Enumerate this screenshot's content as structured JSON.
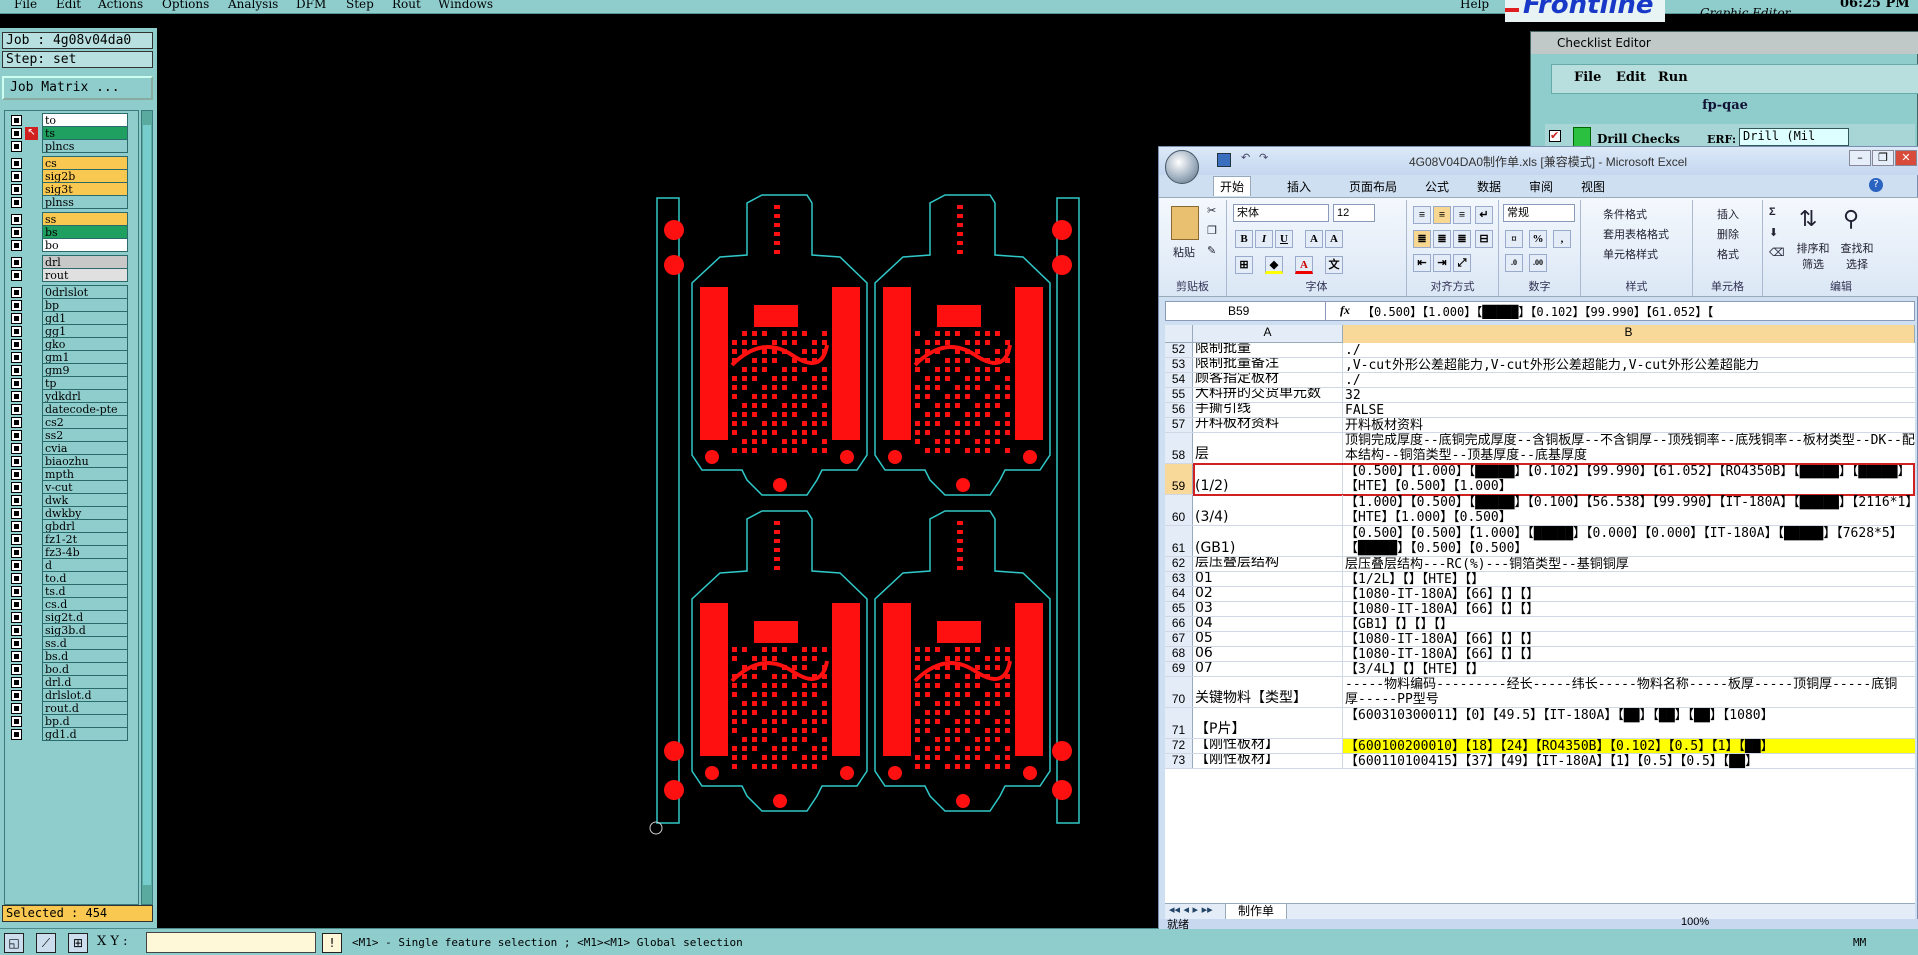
{
  "menubar": {
    "items": [
      "File",
      "Edit",
      "Actions",
      "Options",
      "Analysis",
      "DFM",
      "Step",
      "Rout",
      "Windows"
    ],
    "help": "Help",
    "brand": "Frontline",
    "editor_name": "Graphic Editor",
    "clock": "06:25 PM"
  },
  "leftpanel": {
    "job": "Job : 4g08v04da0",
    "step": "Step: set",
    "job_matrix": "Job Matrix ...",
    "layers": [
      {
        "name": "to",
        "color": "#ffffff"
      },
      {
        "name": "ts",
        "color": "#20a060"
      },
      {
        "name": "plncs",
        "color": "#8fcdcd"
      },
      {
        "name": "cs",
        "color": "#f8c850"
      },
      {
        "name": "sig2b",
        "color": "#f8c850"
      },
      {
        "name": "sig3t",
        "color": "#f8c850"
      },
      {
        "name": "plnss",
        "color": "#8fcdcd"
      },
      {
        "name": "ss",
        "color": "#f8c850"
      },
      {
        "name": "bs",
        "color": "#20a060"
      },
      {
        "name": "bo",
        "color": "#ffffff"
      },
      {
        "name": "drl",
        "color": "#c8c8c8"
      },
      {
        "name": "rout",
        "color": "#e0e0e0"
      },
      {
        "name": "0drlslot",
        "color": "#8fcdcd"
      },
      {
        "name": "bp",
        "color": "#8fcdcd"
      },
      {
        "name": "gd1",
        "color": "#8fcdcd"
      },
      {
        "name": "gg1",
        "color": "#8fcdcd"
      },
      {
        "name": "gko",
        "color": "#8fcdcd"
      },
      {
        "name": "gm1",
        "color": "#8fcdcd"
      },
      {
        "name": "gm9",
        "color": "#8fcdcd"
      },
      {
        "name": "tp",
        "color": "#8fcdcd"
      },
      {
        "name": "ydkdrl",
        "color": "#8fcdcd"
      },
      {
        "name": "datecode-pte",
        "color": "#8fcdcd"
      },
      {
        "name": "cs2",
        "color": "#8fcdcd"
      },
      {
        "name": "ss2",
        "color": "#8fcdcd"
      },
      {
        "name": "cvia",
        "color": "#8fcdcd"
      },
      {
        "name": "biaozhu",
        "color": "#8fcdcd"
      },
      {
        "name": "mpth",
        "color": "#8fcdcd"
      },
      {
        "name": "v-cut",
        "color": "#8fcdcd"
      },
      {
        "name": "dwk",
        "color": "#8fcdcd"
      },
      {
        "name": "dwkby",
        "color": "#8fcdcd"
      },
      {
        "name": "gbdrl",
        "color": "#8fcdcd"
      },
      {
        "name": "fz1-2t",
        "color": "#8fcdcd"
      },
      {
        "name": "fz3-4b",
        "color": "#8fcdcd"
      },
      {
        "name": "d",
        "color": "#8fcdcd"
      },
      {
        "name": "to.d",
        "color": "#8fcdcd"
      },
      {
        "name": "ts.d",
        "color": "#8fcdcd"
      },
      {
        "name": "cs.d",
        "color": "#8fcdcd"
      },
      {
        "name": "sig2t.d",
        "color": "#8fcdcd"
      },
      {
        "name": "sig3b.d",
        "color": "#8fcdcd"
      },
      {
        "name": "ss.d",
        "color": "#8fcdcd"
      },
      {
        "name": "bs.d",
        "color": "#8fcdcd"
      },
      {
        "name": "bo.d",
        "color": "#8fcdcd"
      },
      {
        "name": "drl.d",
        "color": "#8fcdcd"
      },
      {
        "name": "drlslot.d",
        "color": "#8fcdcd"
      },
      {
        "name": "rout.d",
        "color": "#8fcdcd"
      },
      {
        "name": "bp.d",
        "color": "#8fcdcd"
      },
      {
        "name": "gd1.d",
        "color": "#8fcdcd"
      }
    ],
    "selected": "Selected : 454"
  },
  "bottombar": {
    "xy_label": "X Y :",
    "xy_value": "",
    "hint": "<M1> - Single feature selection ; <M1><M1> Global selection",
    "units": "MM"
  },
  "checklist": {
    "title": "Checklist Editor",
    "menu": [
      "File",
      "Edit",
      "Run"
    ],
    "name": "fp-qae",
    "item": "Drill Checks",
    "erf_label": "ERF:",
    "erf_value": "Drill (Mil"
  },
  "excel": {
    "title": "4G08V04DA0制作单.xls  [兼容模式] - Microsoft Excel",
    "tabs": [
      "开始",
      "插入",
      "页面布局",
      "公式",
      "数据",
      "审阅",
      "视图"
    ],
    "ribbon": {
      "paste": "粘贴",
      "clipboard": "剪贴板",
      "font_name": "宋体",
      "font_size": "12",
      "font": "字体",
      "alignment": "对齐方式",
      "number_format": "常规",
      "number": "数字",
      "cond_format": "条件格式",
      "table_format": "套用表格格式",
      "cell_style": "单元格样式",
      "styles": "样式",
      "insert": "插入",
      "delete": "删除",
      "format": "格式",
      "cells": "单元格",
      "sort_filter": "排序和筛选",
      "find_select": "查找和选择",
      "editing": "编辑"
    },
    "namebox": "B59",
    "formula": "【0.500】【1.000】【█████】【0.102】【99.990】【61.052】【",
    "columns": [
      "A",
      "B"
    ],
    "rows": [
      {
        "n": "52",
        "a": "限制批量",
        "b": "./"
      },
      {
        "n": "53",
        "a": "限制批量备注",
        "b": ",V-cut外形公差超能力,V-cut外形公差超能力,V-cut外形公差超能力"
      },
      {
        "n": "54",
        "a": "顾客指定板材",
        "b": "./"
      },
      {
        "n": "55",
        "a": "大料拼的交货单元数",
        "b": "32"
      },
      {
        "n": "56",
        "a": "手撕引线",
        "b": "FALSE"
      },
      {
        "n": "57",
        "a": "开料板材资料",
        "b": "开料板材资料"
      },
      {
        "n": "58",
        "a": "层",
        "b": "顶铜完成厚度--底铜完成厚度--含铜板厚--不含铜厚--顶残铜率--底残铜率--板材类型--DK--配本结构--铜箔类型--顶基厚度--底基厚度"
      },
      {
        "n": "59",
        "a": "(1/2)",
        "b": "【0.500】【1.000】【█████】【0.102】【99.990】【61.052】【RO4350B】【█████】【█████】【HTE】【0.500】【1.000】"
      },
      {
        "n": "60",
        "a": "(3/4)",
        "b": "【1.000】【0.500】【█████】【0.100】【56.538】【99.990】【IT-180A】【█████】【2116*1】【HTE】【1.000】【0.500】"
      },
      {
        "n": "61",
        "a": "(GB1)",
        "b": "【0.500】【0.500】【1.000】【█████】【0.000】【0.000】【IT-180A】【█████】【7628*5】【█████】【0.500】【0.500】"
      },
      {
        "n": "62",
        "a": "层压叠层结构",
        "b": "层压叠层结构---RC(%)---铜箔类型--基铜铜厚"
      },
      {
        "n": "63",
        "a": "01",
        "b": "【1/2L】【】【HTE】【】"
      },
      {
        "n": "64",
        "a": "02",
        "b": "【1080-IT-180A】【66】【】【】"
      },
      {
        "n": "65",
        "a": "03",
        "b": "【1080-IT-180A】【66】【】【】"
      },
      {
        "n": "66",
        "a": "04",
        "b": "【GB1】【】【】【】"
      },
      {
        "n": "67",
        "a": "05",
        "b": "【1080-IT-180A】【66】【】【】"
      },
      {
        "n": "68",
        "a": "06",
        "b": "【1080-IT-180A】【66】【】【】"
      },
      {
        "n": "69",
        "a": "07",
        "b": "【3/4L】【】【HTE】【】"
      },
      {
        "n": "70",
        "a": "关键物料【类型】",
        "b": "-----物料编码---------经长-----纬长-----物料名称-----板厚-----顶铜厚-----底铜厚-----PP型号"
      },
      {
        "n": "71",
        "a": "【P片】",
        "b": "【600310300011】【0】【49.5】【IT-180A】【██】【██】【██】【1080】"
      },
      {
        "n": "72",
        "a": "【刚性板材】",
        "b": "【600100200010】【18】【24】【RO4350B】【0.102】【0.5】【1】【██】"
      },
      {
        "n": "73",
        "a": "【刚性板材】",
        "b": "【600110100415】【37】【49】【IT-180A】【1】【0.5】【0.5】【██】"
      }
    ],
    "sheet_tab": "制作单",
    "status_ready": "就绪",
    "zoom": "100%"
  }
}
